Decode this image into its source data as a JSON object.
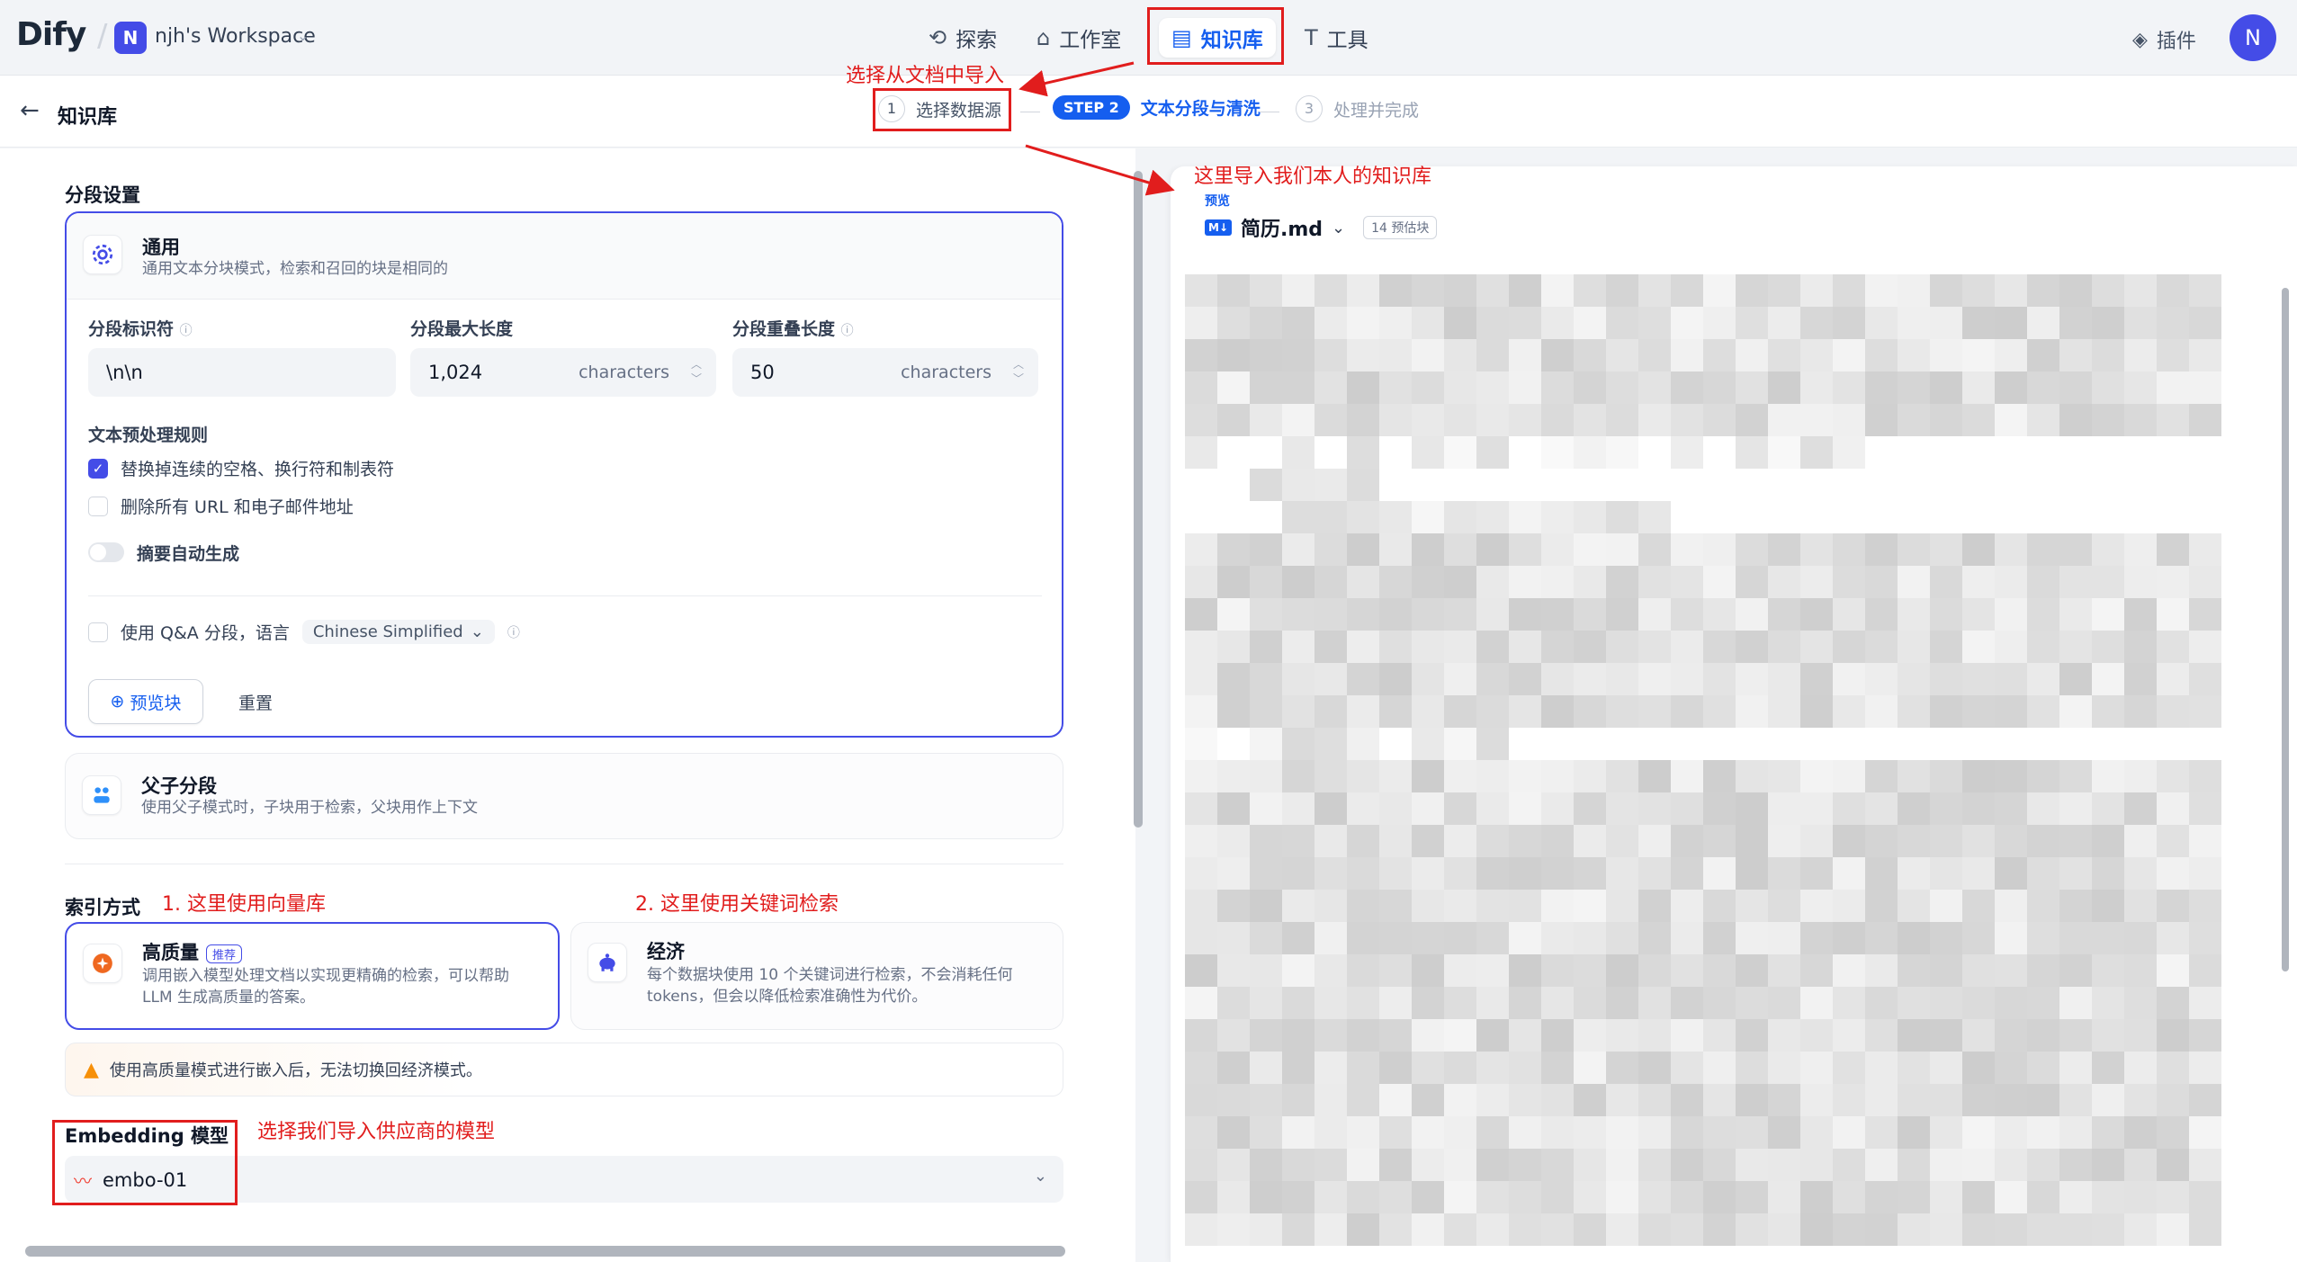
{
  "app": {
    "logo": "Dify",
    "workspace_initial": "N",
    "workspace_name": "njh's Workspace"
  },
  "nav": [
    {
      "icon": "compass-icon",
      "label": "探索"
    },
    {
      "icon": "robot-icon",
      "label": "工作室"
    },
    {
      "icon": "book-icon",
      "label": "知识库",
      "active": true
    },
    {
      "icon": "tool-icon",
      "label": "工具"
    }
  ],
  "plugin_label": "插件",
  "user_initial": "N",
  "page": {
    "title": "知识库"
  },
  "steps": [
    {
      "num": "1",
      "label": "选择数据源"
    },
    {
      "badge": "STEP 2",
      "label": "文本分段与清洗"
    },
    {
      "num": "3",
      "label": "处理并完成"
    }
  ],
  "segment_settings": {
    "title": "分段设置",
    "general": {
      "title": "通用",
      "desc": "通用文本分块模式，检索和召回的块是相同的"
    },
    "delimiter": {
      "label": "分段标识符",
      "value": "\\n\\n"
    },
    "max_length": {
      "label": "分段最大长度",
      "value": "1,024",
      "unit": "characters"
    },
    "overlap": {
      "label": "分段重叠长度",
      "value": "50",
      "unit": "characters"
    },
    "rules_title": "文本预处理规则",
    "rule1": "替换掉连续的空格、换行符和制表符",
    "rule2": "删除所有 URL 和电子邮件地址",
    "auto_summary": "摘要自动生成",
    "qa_label": "使用 Q&A 分段，语言",
    "qa_language": "Chinese Simplified",
    "preview_btn": "预览块",
    "reset_btn": "重置",
    "parent_child": {
      "title": "父子分段",
      "desc": "使用父子模式时，子块用于检索，父块用作上下文"
    }
  },
  "index": {
    "title": "索引方式",
    "high": {
      "title": "高质量",
      "tag": "推荐",
      "desc1": "调用嵌入模型处理文档以实现更精确的检索，可以帮助",
      "desc2": "LLM 生成高质量的答案。"
    },
    "eco": {
      "title": "经济",
      "desc1": "每个数据块使用 10 个关键词进行检索，不会消耗任何",
      "desc2": "tokens，但会以降低检索准确性为代价。"
    },
    "warning": "使用高质量模式进行嵌入后，无法切换回经济模式。"
  },
  "embedding": {
    "title": "Embedding 模型",
    "model": "embo-01"
  },
  "preview": {
    "label": "预览",
    "file_badge": "M↓",
    "file_name": "简历.md",
    "count": "14 预估块"
  },
  "annotations": {
    "a1": "选择从文档中导入",
    "a2": "这里导入我们本人的知识库",
    "a3": "1. 这里使用向量库",
    "a4": "2. 这里使用关键词检索",
    "a5": "选择我们导入供应商的模型"
  },
  "colors": {
    "accent": "#155eef",
    "primary": "#444ce7",
    "annotation": "#e11d1d"
  }
}
